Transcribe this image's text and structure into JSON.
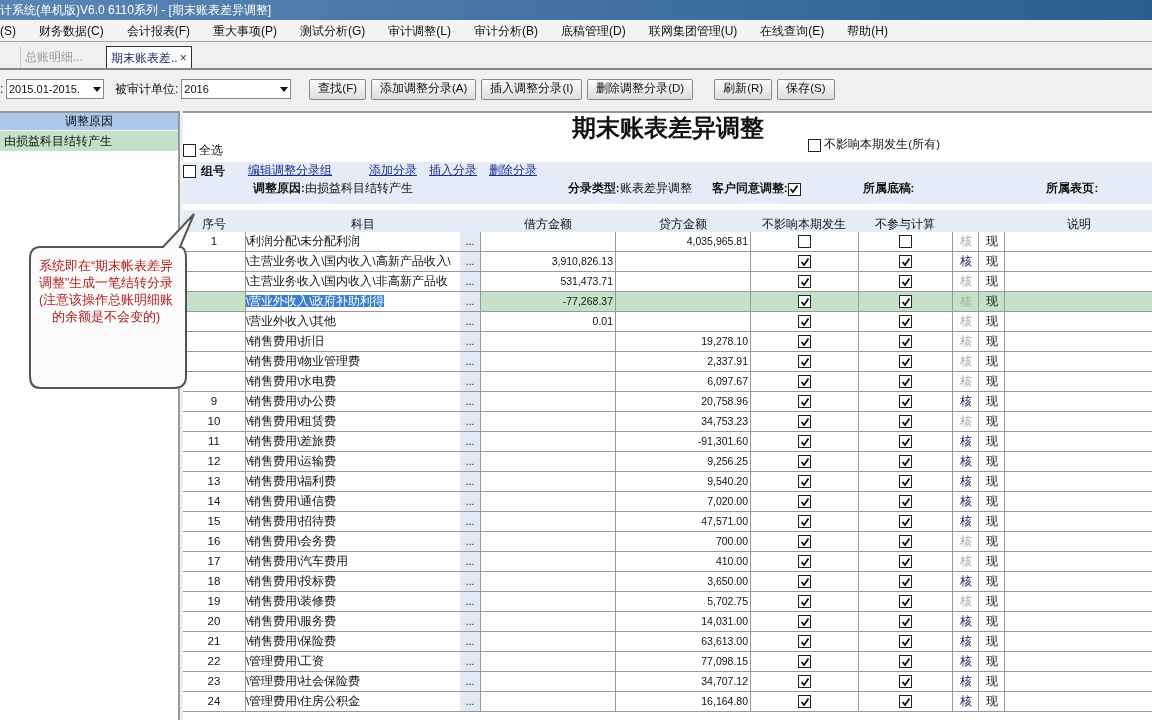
{
  "window": {
    "title": "计系统(单机版)V6.0 6110系列 - [期末账表差异调整]"
  },
  "menu": [
    "(S)",
    "财务数据(C)",
    "会计报表(F)",
    "重大事项(P)",
    "测试分析(G)",
    "审计调整(L)",
    "审计分析(B)",
    "底稿管理(D)",
    "联网集团管理(U)",
    "在线查询(E)",
    "帮助(H)"
  ],
  "tabs": [
    {
      "label": "总账明细...",
      "selected": false
    },
    {
      "label": "期末账表差..",
      "selected": true,
      "close": "×"
    }
  ],
  "toolbar": {
    "period_label": ":",
    "period": "2015.01-2015.",
    "unit_label": "被审计单位:",
    "unit": "2016",
    "buttons": [
      "查找(F)",
      "添加调整分录(A)",
      "插入调整分录(I)",
      "删除调整分录(D)",
      "刷新(R)",
      "保存(S)"
    ]
  },
  "left_panel": {
    "header": "调整原因",
    "items": [
      {
        "label": "由损益科目结转产生",
        "selected": true
      }
    ]
  },
  "main": {
    "title": "期末账表差异调整",
    "select_all": {
      "label": "全选",
      "checked": false
    },
    "not_affect_all": {
      "label": "不影响本期发生(所有)",
      "checked": false
    },
    "group": {
      "label": "组号",
      "checked": false
    },
    "links": [
      "编辑调整分录组",
      "添加分录",
      "插入分录",
      "删除分录"
    ],
    "reason_label": "调整原因:",
    "reason": "由损益科目结转产生",
    "type_label": "分录类型:",
    "type": "账表差异调整",
    "client_agree_label": "客户同意调整:",
    "client_agree": true,
    "draft_label": "所属底稿:",
    "page_label": "所属表页:",
    "columns": [
      "序号",
      "科目",
      "借方金额",
      "贷方金额",
      "不影响本期发生",
      "不参与计算",
      "说明"
    ],
    "rows": [
      {
        "seq": "1",
        "subject": "\\利润分配\\未分配利润",
        "debit": "",
        "credit": "4,035,965.81",
        "not_affect": false,
        "excluded": false,
        "verify": "核",
        "verify_enabled": false,
        "show": "现",
        "selected": false
      },
      {
        "subject": "\\主营业务收入\\国内收入\\高新产品收入\\",
        "debit": "3,910,826.13",
        "credit": "",
        "not_affect": true,
        "excluded": true,
        "verify": "核",
        "verify_enabled": true,
        "show": "现",
        "selected": false
      },
      {
        "subject": "\\主营业务收入\\国内收入\\非高新产品收",
        "debit": "531,473.71",
        "credit": "",
        "not_affect": true,
        "excluded": true,
        "verify": "核",
        "verify_enabled": false,
        "show": "现",
        "selected": false
      },
      {
        "subject": "\\营业外收入\\政府补助利得",
        "debit": "-77,268.37",
        "credit": "",
        "not_affect": true,
        "excluded": true,
        "verify": "核",
        "verify_enabled": false,
        "show": "现",
        "selected": true
      },
      {
        "subject": "\\营业外收入\\其他",
        "debit": "0.01",
        "credit": "",
        "not_affect": true,
        "excluded": true,
        "verify": "核",
        "verify_enabled": false,
        "show": "现",
        "selected": false
      },
      {
        "subject": "\\销售费用\\折旧",
        "debit": "",
        "credit": "19,278.10",
        "not_affect": true,
        "excluded": true,
        "verify": "核",
        "verify_enabled": false,
        "show": "现",
        "selected": false
      },
      {
        "subject": "\\销售费用\\物业管理费",
        "debit": "",
        "credit": "2,337.91",
        "not_affect": true,
        "excluded": true,
        "verify": "核",
        "verify_enabled": false,
        "show": "现",
        "selected": false
      },
      {
        "subject": "\\销售费用\\水电费",
        "debit": "",
        "credit": "6,097.67",
        "not_affect": true,
        "excluded": true,
        "verify": "核",
        "verify_enabled": false,
        "show": "现",
        "selected": false
      },
      {
        "seq": "9",
        "subject": "\\销售费用\\办公费",
        "debit": "",
        "credit": "20,758.96",
        "not_affect": true,
        "excluded": true,
        "verify": "核",
        "verify_enabled": true,
        "show": "现",
        "selected": false
      },
      {
        "seq": "10",
        "subject": "\\销售费用\\租赁费",
        "debit": "",
        "credit": "34,753.23",
        "not_affect": true,
        "excluded": true,
        "verify": "核",
        "verify_enabled": false,
        "show": "现",
        "selected": false
      },
      {
        "seq": "11",
        "subject": "\\销售费用\\差旅费",
        "debit": "",
        "credit": "-91,301.60",
        "not_affect": true,
        "excluded": true,
        "verify": "核",
        "verify_enabled": true,
        "show": "现",
        "selected": false
      },
      {
        "seq": "12",
        "subject": "\\销售费用\\运输费",
        "debit": "",
        "credit": "9,256.25",
        "not_affect": true,
        "excluded": true,
        "verify": "核",
        "verify_enabled": true,
        "show": "现",
        "selected": false
      },
      {
        "seq": "13",
        "subject": "\\销售费用\\福利费",
        "debit": "",
        "credit": "9,540.20",
        "not_affect": true,
        "excluded": true,
        "verify": "核",
        "verify_enabled": true,
        "show": "现",
        "selected": false
      },
      {
        "seq": "14",
        "subject": "\\销售费用\\通信费",
        "debit": "",
        "credit": "7,020.00",
        "not_affect": true,
        "excluded": true,
        "verify": "核",
        "verify_enabled": true,
        "show": "现",
        "selected": false
      },
      {
        "seq": "15",
        "subject": "\\销售费用\\招待费",
        "debit": "",
        "credit": "47,571.00",
        "not_affect": true,
        "excluded": true,
        "verify": "核",
        "verify_enabled": true,
        "show": "现",
        "selected": false
      },
      {
        "seq": "16",
        "subject": "\\销售费用\\会务费",
        "debit": "",
        "credit": "700.00",
        "not_affect": true,
        "excluded": true,
        "verify": "核",
        "verify_enabled": false,
        "show": "现",
        "selected": false
      },
      {
        "seq": "17",
        "subject": "\\销售费用\\汽车费用",
        "debit": "",
        "credit": "410.00",
        "not_affect": true,
        "excluded": true,
        "verify": "核",
        "verify_enabled": false,
        "show": "现",
        "selected": false
      },
      {
        "seq": "18",
        "subject": "\\销售费用\\投标费",
        "debit": "",
        "credit": "3,650.00",
        "not_affect": true,
        "excluded": true,
        "verify": "核",
        "verify_enabled": true,
        "show": "现",
        "selected": false
      },
      {
        "seq": "19",
        "subject": "\\销售费用\\装修费",
        "debit": "",
        "credit": "5,702.75",
        "not_affect": true,
        "excluded": true,
        "verify": "核",
        "verify_enabled": false,
        "show": "现",
        "selected": false
      },
      {
        "seq": "20",
        "subject": "\\销售费用\\服务费",
        "debit": "",
        "credit": "14,031.00",
        "not_affect": true,
        "excluded": true,
        "verify": "核",
        "verify_enabled": true,
        "show": "现",
        "selected": false
      },
      {
        "seq": "21",
        "subject": "\\销售费用\\保险费",
        "debit": "",
        "credit": "63,613.00",
        "not_affect": true,
        "excluded": true,
        "verify": "核",
        "verify_enabled": true,
        "show": "现",
        "selected": false
      },
      {
        "seq": "22",
        "subject": "\\管理费用\\工资",
        "debit": "",
        "credit": "77,098.15",
        "not_affect": true,
        "excluded": true,
        "verify": "核",
        "verify_enabled": true,
        "show": "现",
        "selected": false
      },
      {
        "seq": "23",
        "subject": "\\管理费用\\社会保险费",
        "debit": "",
        "credit": "34,707.12",
        "not_affect": true,
        "excluded": true,
        "verify": "核",
        "verify_enabled": true,
        "show": "现",
        "selected": false
      },
      {
        "seq": "24",
        "subject": "\\管理费用\\住房公积金",
        "debit": "",
        "credit": "16,164.80",
        "not_affect": true,
        "excluded": true,
        "verify": "核",
        "verify_enabled": true,
        "show": "现",
        "selected": false
      }
    ],
    "ellipsis": "...",
    "callout": "系统即在“期末帐表差异调整”生成一笔结转分录(注意该操作总账明细账的余额是不会变的)"
  }
}
